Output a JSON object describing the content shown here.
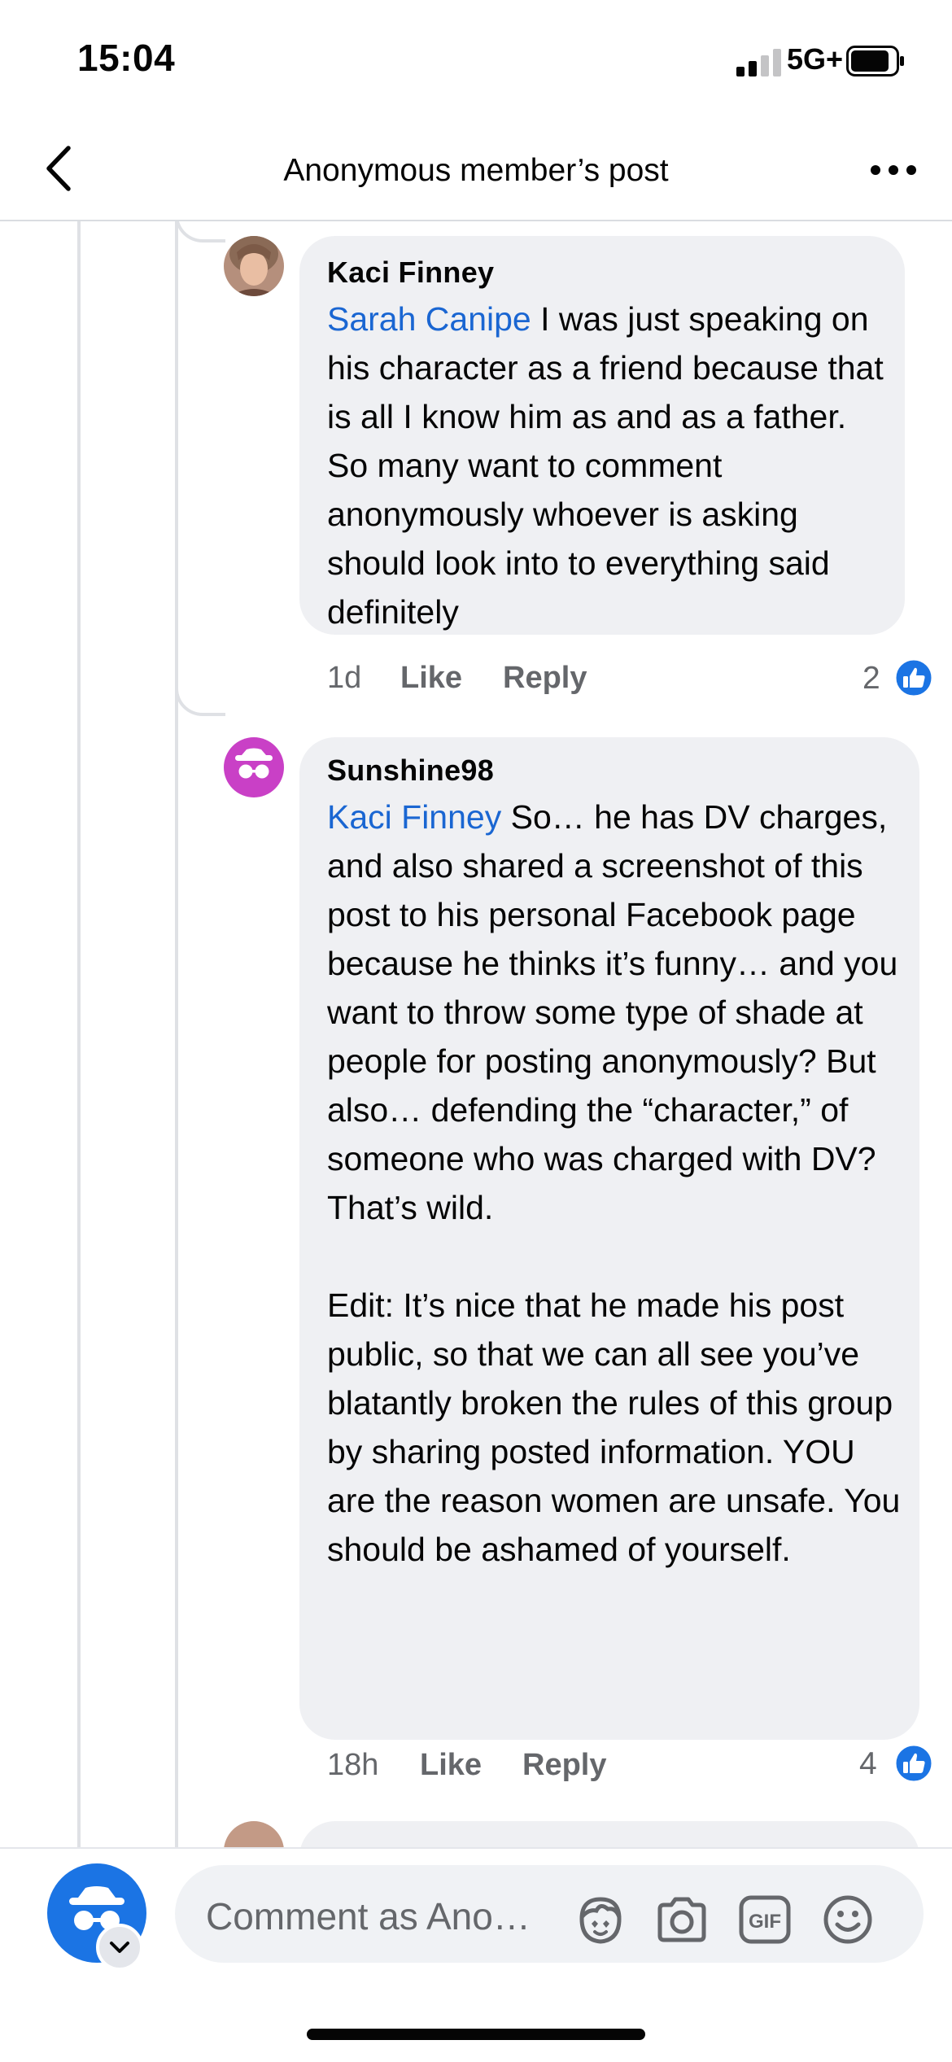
{
  "status_bar": {
    "time": "15:04",
    "network": "5G+"
  },
  "header": {
    "title": "Anonymous member’s post"
  },
  "comments": [
    {
      "author": "Kaci Finney",
      "mention": "Sarah Canipe",
      "text": " I was just speaking on his character as a friend because that is all I know him as and as a father. So many want to comment anonymously whoever is asking should look into to everything said definitely",
      "time": "1d",
      "like_label": "Like",
      "reply_label": "Reply",
      "reaction_count": "2"
    },
    {
      "author": "Sunshine98",
      "mention": "Kaci Finney",
      "text": " So… he has DV charges, and also shared a screenshot of this post to his personal Facebook page because he thinks it’s funny… and you want to throw some type of shade at people for posting anonymously? But also… defending the “character,” of someone who was charged with DV? That’s wild.\n\nEdit: It’s nice that he made his post public, so that we can all see you’ve blatantly broken the rules of this group by sharing posted information. YOU are the reason women are unsafe. You should be ashamed of yourself.",
      "time": "18h",
      "like_label": "Like",
      "reply_label": "Reply",
      "reaction_count": "4"
    }
  ],
  "composer": {
    "placeholder": "Comment as Ano…"
  },
  "colors": {
    "accent": "#1b74e4",
    "mention": "#1a66d2",
    "anon_avatar": "#c940c6",
    "bubble": "#eff0f3"
  },
  "icons": [
    "back-icon",
    "more-icon",
    "incognito-icon",
    "like-icon",
    "avatar-sticker-icon",
    "camera-icon",
    "gif-icon",
    "emoji-icon",
    "chevron-down-icon"
  ]
}
